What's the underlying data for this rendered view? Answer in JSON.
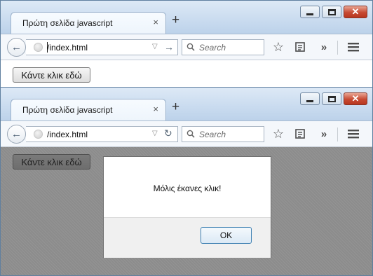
{
  "top_window": {
    "tab": {
      "title": "Πρώτη σελίδα javascript",
      "close": "×"
    },
    "new_tab": "+",
    "url": "/index.html",
    "search_placeholder": "Search",
    "page": {
      "button_label": "Κάντε κλικ εδώ"
    }
  },
  "bottom_window": {
    "tab": {
      "title": "Πρώτη σελίδα javascript",
      "close": "×"
    },
    "new_tab": "+",
    "url": "/index.html",
    "search_placeholder": "Search",
    "page": {
      "button_label": "Κάντε κλικ εδώ"
    },
    "alert": {
      "message": "Μόλις έκανες κλικ!",
      "ok_label": "OK"
    }
  },
  "icons": {
    "back": "back-arrow-icon",
    "site": "globe-icon",
    "go": "go-arrow-icon",
    "reload": "reload-icon",
    "search": "search-icon",
    "bookmark": "star-icon",
    "reader": "reading-list-icon",
    "overflow": "chevron-double-right-icon",
    "menu": "hamburger-menu-icon"
  },
  "colors": {
    "titlebar": "#c9dbef",
    "overlay": "#8c8c8c",
    "ok_border": "#3c7fb1",
    "close_button": "#c74a33"
  }
}
